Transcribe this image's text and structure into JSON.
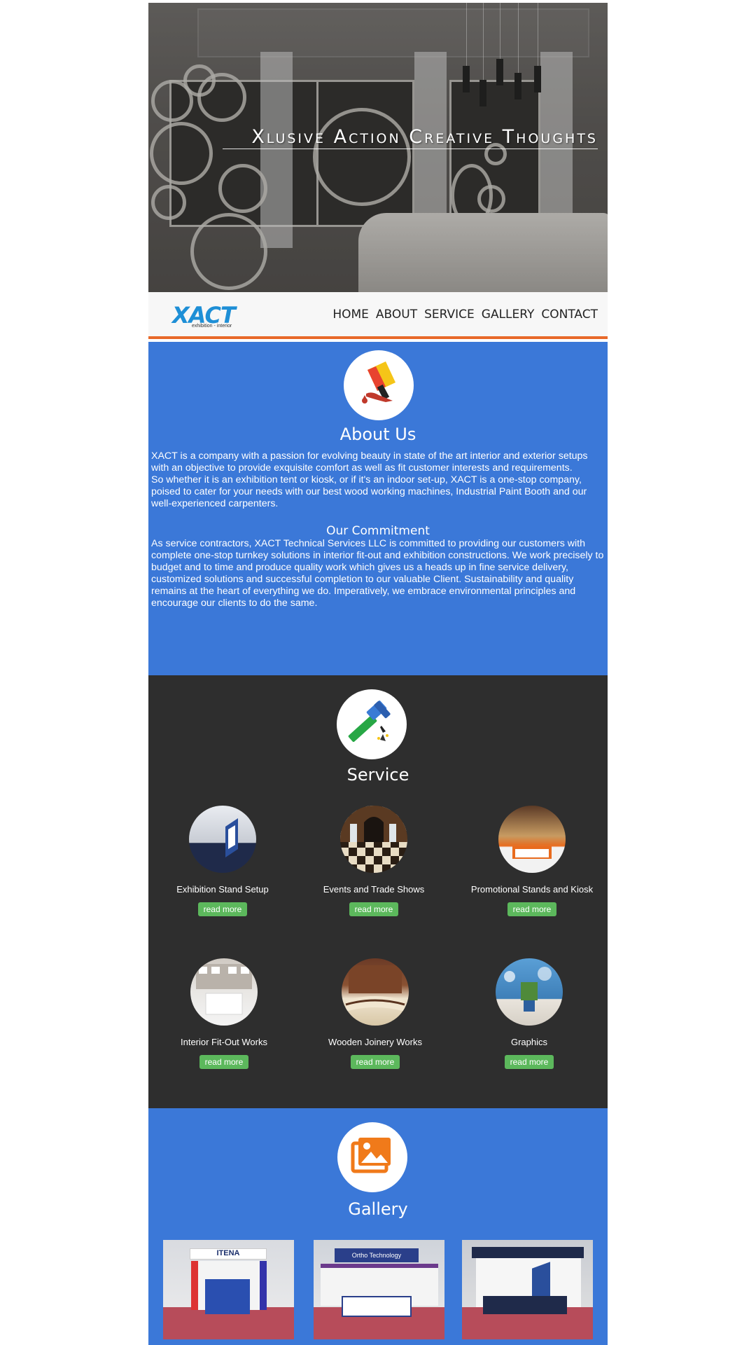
{
  "hero": {
    "title": "Xlusive Action Creative Thoughts"
  },
  "header": {
    "logo_text": "XACT",
    "logo_sub": "exhibition - interior",
    "nav": [
      "HOME",
      "ABOUT",
      "SERVICE",
      "GALLERY",
      "CONTACT"
    ]
  },
  "about": {
    "icon": "paint-brush-icon",
    "title": "About Us",
    "text": "XACT is a company with a passion for evolving beauty in state of the art interior and exterior setups with an objective to provide exquisite comfort as well as fit customer interests and requirements.\nSo whether it is an exhibition tent or kiosk, or if it's an indoor set-up, XACT is a one-stop company, poised to cater for your needs with our best wood working machines, Industrial Paint Booth and our well-experienced carpenters.",
    "commitment_title": "Our Commitment",
    "commitment_text": "As service contractors, XACT Technical Services LLC is committed to providing our customers with complete one-stop turnkey solutions in interior fit-out and exhibition constructions. We work precisely to budget and to time and produce quality work which gives us a heads up in fine service delivery, customized solutions and successful completion to our valuable Client. Sustainability and quality remains at the heart of everything we do. Imperatively, we embrace environmental principles and encourage our clients to do the same."
  },
  "service": {
    "icon": "hammer-icon",
    "title": "Service",
    "items": [
      {
        "label": "Exhibition Stand Setup",
        "button": "read more"
      },
      {
        "label": "Events and Trade Shows",
        "button": "read more"
      },
      {
        "label": "Promotional Stands and Kiosk",
        "button": "read more"
      },
      {
        "label": "Interior Fit-Out Works",
        "button": "read more"
      },
      {
        "label": "Wooden Joinery Works",
        "button": "read more"
      },
      {
        "label": "Graphics",
        "button": "read more"
      }
    ]
  },
  "gallery": {
    "icon": "image-gallery-icon",
    "title": "Gallery",
    "photos": [
      {
        "sign": "ITENA"
      },
      {
        "sign": "Ortho Technology"
      },
      {
        "sign": ""
      }
    ]
  },
  "colors": {
    "accent_blue": "#3b78d8",
    "dark_section": "#2e2e2e",
    "header_border": "#e8692a",
    "button_green": "#5cb85c",
    "logo_blue": "#1e8fd6"
  }
}
